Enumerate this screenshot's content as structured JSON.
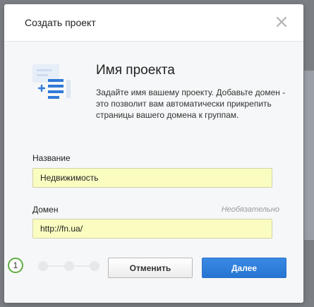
{
  "dialog": {
    "title": "Создать проект"
  },
  "intro": {
    "heading": "Имя проекта",
    "text": "Задайте имя вашему проекту. Добавьте домен - это позволит вам автоматически прикрепить страницы вашего домена к группам."
  },
  "fields": {
    "name": {
      "label": "Название",
      "value": "Недвижимость"
    },
    "domain": {
      "label": "Домен",
      "optional": "Необязательно",
      "value": "http://fn.ua/"
    }
  },
  "stepper": {
    "current_step": "1",
    "total_steps": 4
  },
  "buttons": {
    "cancel": "Отменить",
    "next": "Далее"
  },
  "colors": {
    "accent": "#2674d1",
    "input_bg": "#fbfcc0",
    "step_ring": "#5fae43"
  }
}
